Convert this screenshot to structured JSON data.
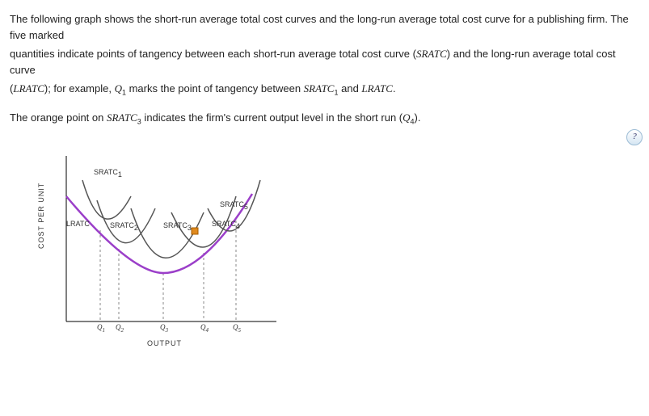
{
  "intro": {
    "p1a": "The following graph shows the short-run average total cost curves and the long-run average total cost curve for a publishing firm. The five marked",
    "p2a": "quantities indicate points of tangency between each short-run average total cost curve (",
    "p2b": "SRATC",
    "p2c": ") and the long-run average total cost curve",
    "p3a": "(",
    "p3b": "LRATC",
    "p3c": "); for example, ",
    "p3d": "Q",
    "p3e": "1",
    "p3f": " marks the point of tangency between ",
    "p3g": "SRATC",
    "p3h": "1",
    "p3i": " and ",
    "p3j": "LRATC",
    "p3k": ".",
    "p4a": "The orange point on ",
    "p4b": "SRATC",
    "p4c": "3",
    "p4d": " indicates the firm's current output level in the short run (",
    "p4e": "Q",
    "p4f": "4",
    "p4g": ")."
  },
  "axis": {
    "y": "COST PER UNIT",
    "x": "OUTPUT"
  },
  "labels": {
    "sratc1": "SRATC",
    "s1sub": "1",
    "sratc2": "SRATC",
    "s2sub": "2",
    "sratc3": "SRATC",
    "s3sub": "3",
    "sratc4": "SRATC",
    "s4sub": "4",
    "sratc5": "SRATC",
    "s5sub": "5",
    "lratc": "LRATC",
    "q1": "Q",
    "q1s": "1",
    "q2": "Q",
    "q2s": "2",
    "q3": "Q",
    "q3s": "3",
    "q4": "Q",
    "q4s": "4",
    "q5": "Q",
    "q5s": "5"
  },
  "help": "?",
  "chart_data": {
    "type": "line",
    "xlabel": "OUTPUT",
    "ylabel": "COST PER UNIT",
    "series": [
      {
        "name": "LRATC",
        "kind": "envelope"
      },
      {
        "name": "SRATC1",
        "tangent_at": "Q1"
      },
      {
        "name": "SRATC2",
        "tangent_at": "Q2"
      },
      {
        "name": "SRATC3",
        "tangent_at": "Q3"
      },
      {
        "name": "SRATC4",
        "tangent_at": "Q4"
      },
      {
        "name": "SRATC5",
        "tangent_at": "Q5"
      }
    ],
    "tangency_points": [
      "Q1",
      "Q2",
      "Q3",
      "Q4",
      "Q5"
    ],
    "current_output": {
      "curve": "SRATC3",
      "x": "Q4",
      "marker": "orange-square"
    }
  }
}
